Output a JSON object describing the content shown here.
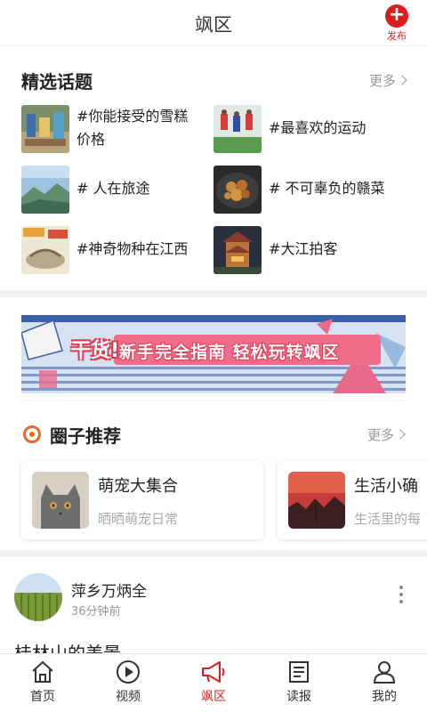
{
  "header": {
    "title": "飒区",
    "publish_label": "发布"
  },
  "topics_section": {
    "title": "精选话题",
    "more": "更多",
    "items": [
      {
        "line1": "#你能接受的雪糕",
        "line2": "价格"
      },
      {
        "line1": "#最喜欢的运动"
      },
      {
        "line1": "# 人在旅途"
      },
      {
        "line1": "# 不可辜负的赣菜"
      },
      {
        "line1": "#神奇物种在江西"
      },
      {
        "line1": "#大江拍客"
      }
    ]
  },
  "banner": {
    "logo_text": "干货!",
    "text": "新手完全指南 轻松玩转飒区"
  },
  "circles_section": {
    "title": "圈子推荐",
    "more": "更多",
    "cards": [
      {
        "name": "萌宠大集合",
        "desc": "晒晒萌宠日常"
      },
      {
        "name": "生活小确",
        "desc": "生活里的每"
      }
    ]
  },
  "post": {
    "user": "萍乡万炳全",
    "time": "36分钟前",
    "title": "桂林山的美景"
  },
  "tabbar": {
    "items": [
      {
        "label": "首页",
        "icon": "home-icon"
      },
      {
        "label": "视频",
        "icon": "play-icon"
      },
      {
        "label": "飒区",
        "icon": "megaphone-icon",
        "active": true
      },
      {
        "label": "读报",
        "icon": "newspaper-icon"
      },
      {
        "label": "我的",
        "icon": "person-icon"
      }
    ],
    "active_color": "#d81e1e"
  },
  "colors": {
    "accent": "#d81e1e",
    "circle_icon": "#e56a2c",
    "banner_bg": "#d8e4f3"
  }
}
